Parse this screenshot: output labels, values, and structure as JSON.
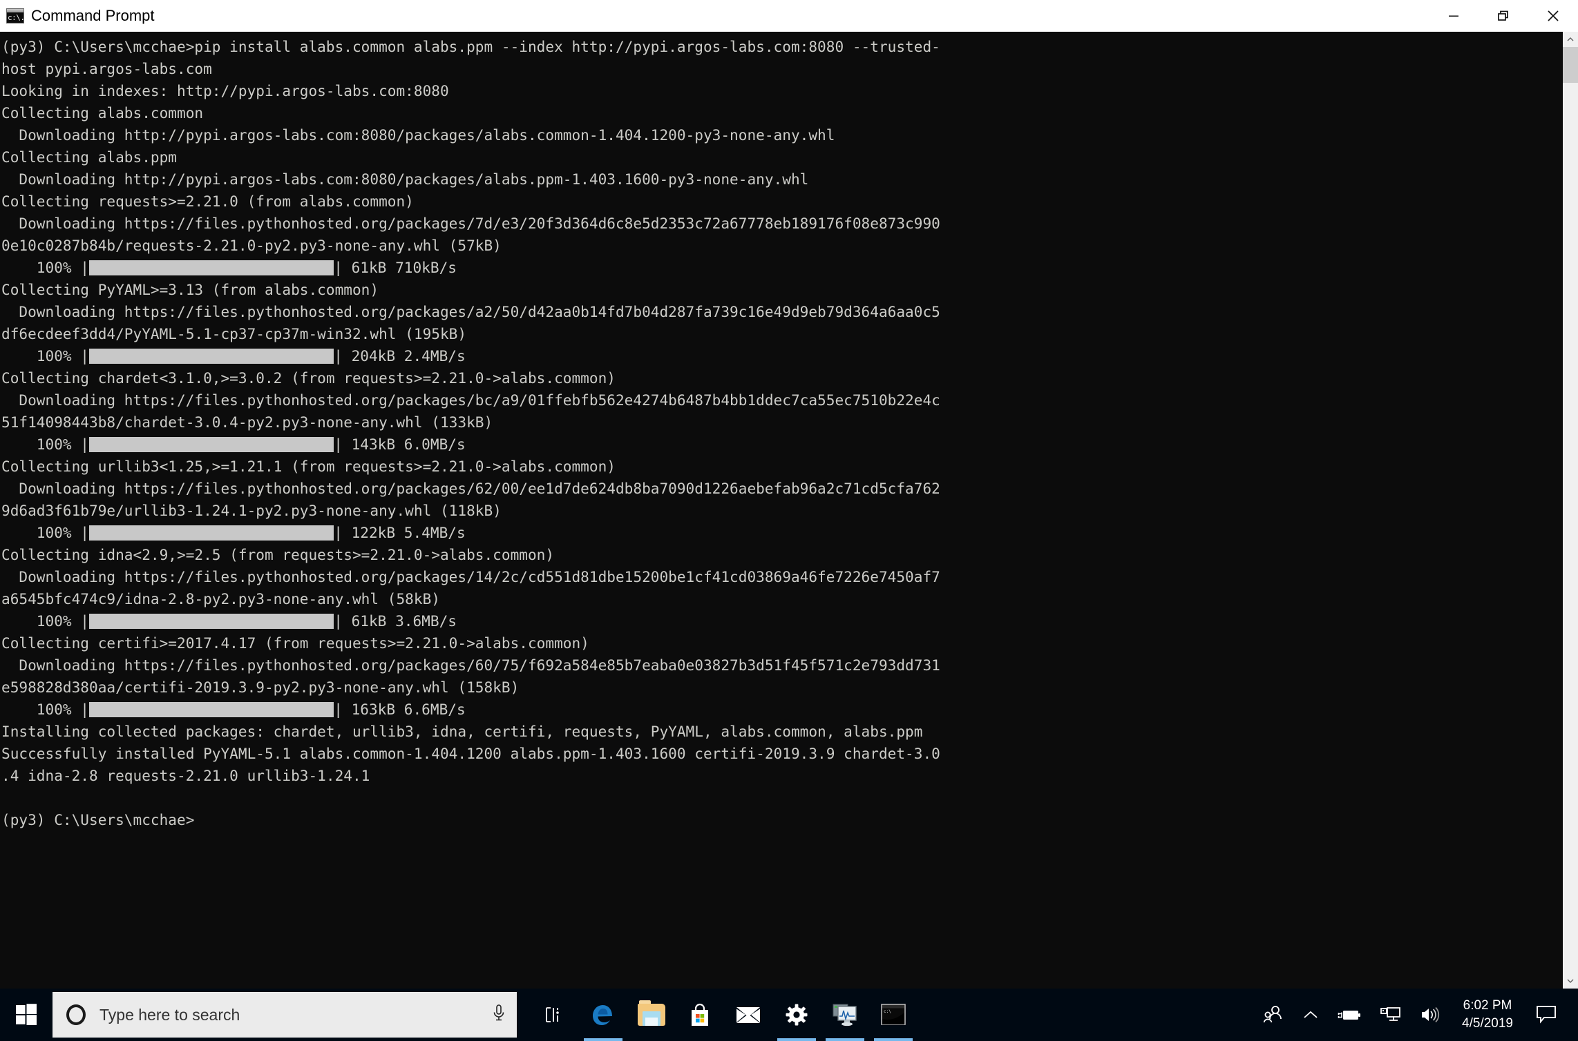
{
  "window": {
    "title": "Command Prompt",
    "icon": "cmd-icon",
    "controls": [
      {
        "name": "minimize",
        "glyph": "minimize-icon"
      },
      {
        "name": "restore",
        "glyph": "restore-icon"
      },
      {
        "name": "close",
        "glyph": "close-icon"
      }
    ]
  },
  "terminal": {
    "prompt_user": "(py3) C:\\Users\\mcchae>",
    "command": "pip install alabs.common alabs.ppm --index http://pypi.argos-labs.com:8080 --trusted-host pypi.argos-labs.com",
    "lines": [
      "(py3) C:\\Users\\mcchae>pip install alabs.common alabs.ppm --index http://pypi.argos-labs.com:8080 --trusted-host pypi.argos-labs.com",
      "Looking in indexes: http://pypi.argos-labs.com:8080",
      "Collecting alabs.common",
      "  Downloading http://pypi.argos-labs.com:8080/packages/alabs.common-1.404.1200-py3-none-any.whl",
      "Collecting alabs.ppm",
      "  Downloading http://pypi.argos-labs.com:8080/packages/alabs.ppm-1.403.1600-py3-none-any.whl",
      "Collecting requests>=2.21.0 (from alabs.common)",
      "  Downloading https://files.pythonhosted.org/packages/7d/e3/20f3d364d6c8e5d2353c72a67778eb189176f08e873c9900e10c0287b84b/requests-2.21.0-py2.py3-none-any.whl (57kB)",
      "    100% |BAR| 61kB 710kB/s",
      "Collecting PyYAML>=3.13 (from alabs.common)",
      "  Downloading https://files.pythonhosted.org/packages/a2/50/d42aa0b14fd7b04d287fa739c16e49d9eb79d364a6aa0c5df6ecdeef3dd4/PyYAML-5.1-cp37-cp37m-win32.whl (195kB)",
      "    100% |BAR| 204kB 2.4MB/s",
      "Collecting chardet<3.1.0,>=3.0.2 (from requests>=2.21.0->alabs.common)",
      "  Downloading https://files.pythonhosted.org/packages/bc/a9/01ffebfb562e4274b6487b4bb1ddec7ca55ec7510b22e4c51f14098443b8/chardet-3.0.4-py2.py3-none-any.whl (133kB)",
      "    100% |BAR| 143kB 6.0MB/s",
      "Collecting urllib3<1.25,>=1.21.1 (from requests>=2.21.0->alabs.common)",
      "  Downloading https://files.pythonhosted.org/packages/62/00/ee1d7de624db8ba7090d1226aebefab96a2c71cd5cfa7629d6ad3f61b79e/urllib3-1.24.1-py2.py3-none-any.whl (118kB)",
      "    100% |BAR| 122kB 5.4MB/s",
      "Collecting idna<2.9,>=2.5 (from requests>=2.21.0->alabs.common)",
      "  Downloading https://files.pythonhosted.org/packages/14/2c/cd551d81dbe15200be1cf41cd03869a46fe7226e7450af7a6545bfc474c9/idna-2.8-py2.py3-none-any.whl (58kB)",
      "    100% |BAR| 61kB 3.6MB/s",
      "Collecting certifi>=2017.4.17 (from requests>=2.21.0->alabs.common)",
      "  Downloading https://files.pythonhosted.org/packages/60/75/f692a584e85b7eaba0e03827b3d51f45f571c2e793dd731e598828d380aa/certifi-2019.3.9-py2.py3-none-any.whl (158kB)",
      "    100% |BAR| 163kB 6.6MB/s",
      "Installing collected packages: chardet, urllib3, idna, certifi, requests, PyYAML, alabs.common, alabs.ppm",
      "Successfully installed PyYAML-5.1 alabs.common-1.404.1200 alabs.ppm-1.403.1600 certifi-2019.3.9 chardet-3.0.4 idna-2.8 requests-2.21.0 urllib3-1.24.1",
      "",
      "(py3) C:\\Users\\mcchae>"
    ],
    "progress": [
      {
        "percent": "100%",
        "size": "61kB",
        "speed": "710kB/s"
      },
      {
        "percent": "100%",
        "size": "204kB",
        "speed": "2.4MB/s"
      },
      {
        "percent": "100%",
        "size": "143kB",
        "speed": "6.0MB/s"
      },
      {
        "percent": "100%",
        "size": "122kB",
        "speed": "5.4MB/s"
      },
      {
        "percent": "100%",
        "size": "61kB",
        "speed": "3.6MB/s"
      },
      {
        "percent": "100%",
        "size": "163kB",
        "speed": "6.6MB/s"
      }
    ],
    "colors": {
      "background": "#0c0c0c",
      "foreground": "#ccccc8",
      "progress_bar": "#c8c8c8"
    }
  },
  "scrollbar": {
    "up_arrow": "chevron-up-icon",
    "down_arrow": "chevron-down-icon"
  },
  "taskbar": {
    "start_label": "windows-logo-icon",
    "search": {
      "placeholder": "Type here to search",
      "mic_icon": "microphone-icon",
      "cortana_icon": "cortana-circle-icon"
    },
    "apps": [
      {
        "name": "task-view",
        "icon": "task-view-icon",
        "active": false
      },
      {
        "name": "microsoft-edge",
        "icon": "edge-icon",
        "active": true
      },
      {
        "name": "file-explorer",
        "icon": "folder-icon",
        "active": false
      },
      {
        "name": "microsoft-store",
        "icon": "store-bag-icon",
        "active": false
      },
      {
        "name": "mail",
        "icon": "envelope-icon",
        "active": false
      },
      {
        "name": "settings",
        "icon": "gear-icon",
        "active": true
      },
      {
        "name": "resource-monitor",
        "icon": "monitor-graph-icon",
        "active": true
      },
      {
        "name": "command-prompt",
        "icon": "console-window-icon",
        "active": true
      }
    ],
    "tray": [
      {
        "name": "people",
        "icon": "people-icon"
      },
      {
        "name": "show-hidden-icons",
        "icon": "chevron-up-icon"
      },
      {
        "name": "battery",
        "icon": "battery-charging-icon"
      },
      {
        "name": "network",
        "icon": "network-icon"
      },
      {
        "name": "volume",
        "icon": "speaker-icon"
      }
    ],
    "clock": {
      "time": "6:02 PM",
      "date": "4/5/2019"
    },
    "action_center": {
      "icon": "notification-icon"
    }
  }
}
